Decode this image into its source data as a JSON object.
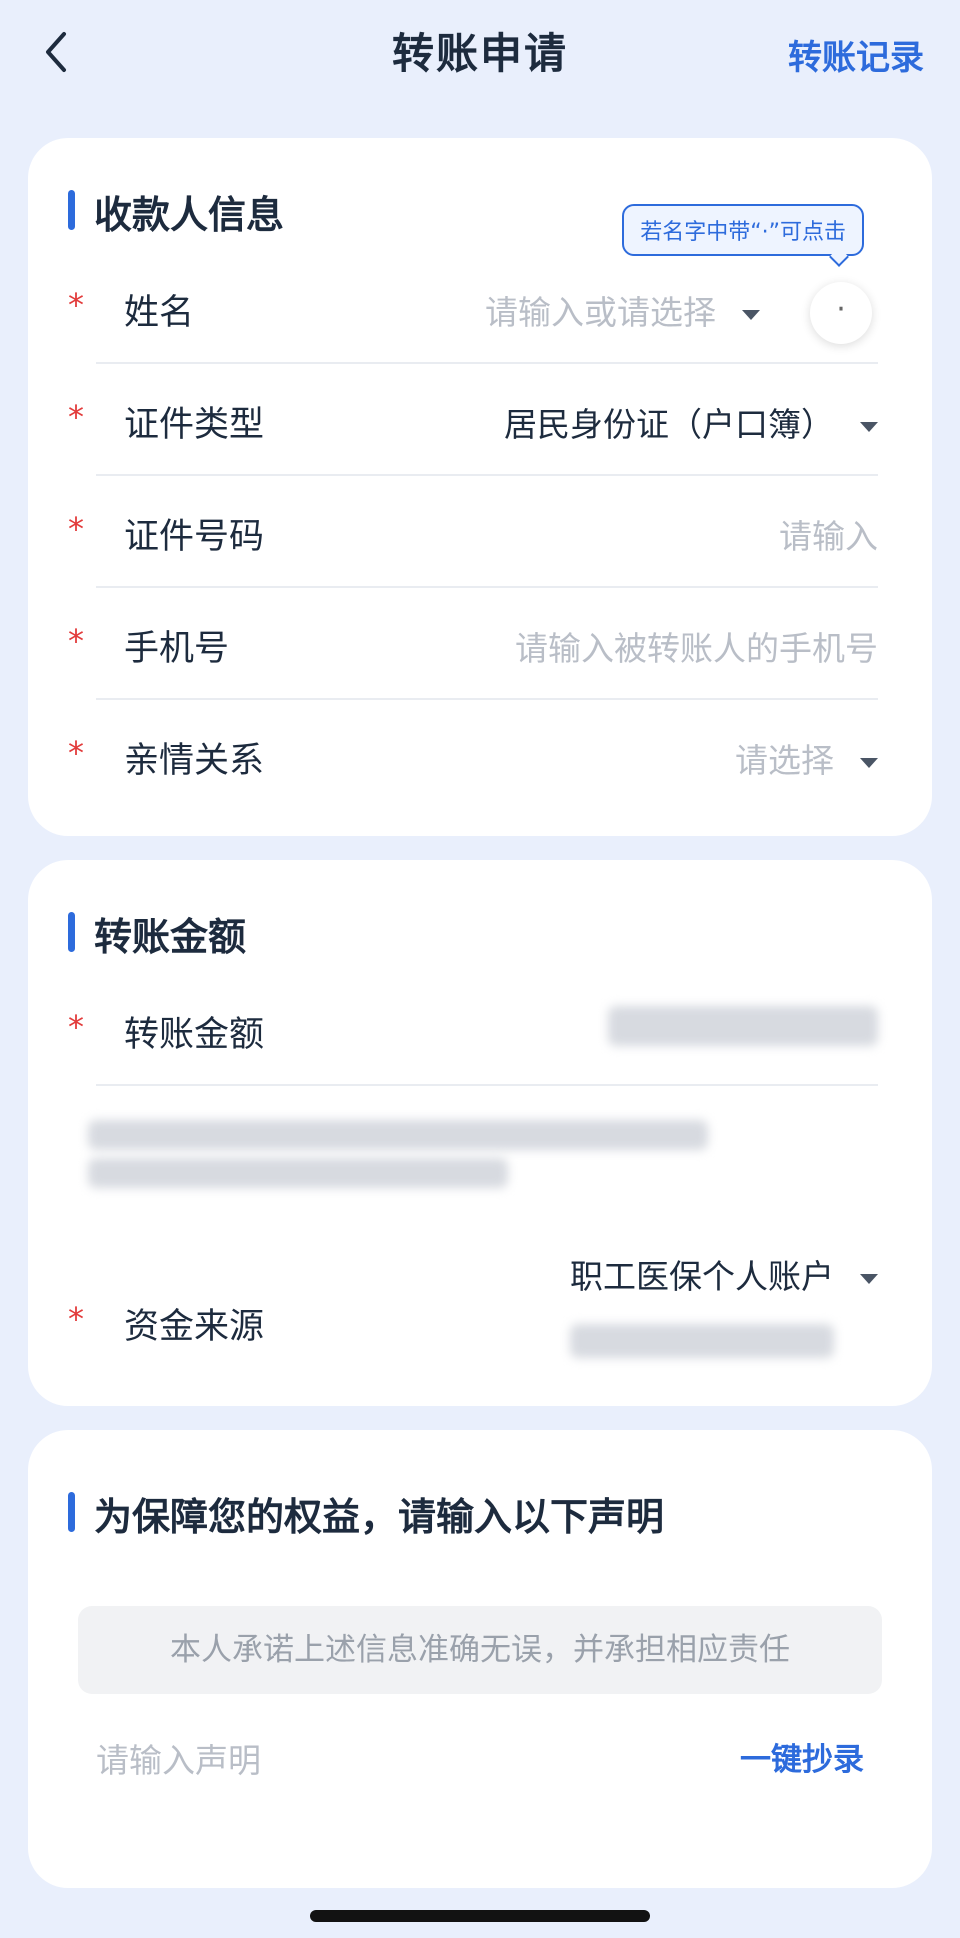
{
  "header": {
    "title": "转账申请",
    "history_link": "转账记录"
  },
  "payee": {
    "section_title": "收款人信息",
    "tooltip": "若名字中带“·”可点击",
    "dot_button": "·",
    "fields": [
      {
        "label": "姓名",
        "value": "",
        "placeholder": "请输入或请选择",
        "has_dropdown": true,
        "required": true
      },
      {
        "label": "证件类型",
        "value": "居民身份证（户口簿）",
        "placeholder": "",
        "has_dropdown": true,
        "required": true
      },
      {
        "label": "证件号码",
        "value": "",
        "placeholder": "请输入",
        "has_dropdown": false,
        "required": true
      },
      {
        "label": "手机号",
        "value": "",
        "placeholder": "请输入被转账人的手机号",
        "has_dropdown": false,
        "required": true
      },
      {
        "label": "亲情关系",
        "value": "",
        "placeholder": "请选择",
        "has_dropdown": true,
        "required": true
      }
    ]
  },
  "amount": {
    "section_title": "转账金额",
    "amount_label": "转账金额",
    "source_label": "资金来源",
    "source_value": "职工医保个人账户",
    "required_mark": "*"
  },
  "declaration": {
    "section_title": "为保障您的权益，请输入以下声明",
    "statement": "本人承诺上述信息准确无误，并承担相应责任",
    "input_placeholder": "请输入声明",
    "copy_button": "一键抄录"
  },
  "colors": {
    "accent": "#2d6bdc",
    "required": "#e23b3b",
    "page_bg": "#e9effc"
  },
  "icons": {
    "back": "chevron-left-icon",
    "dropdown": "caret-down-icon"
  }
}
